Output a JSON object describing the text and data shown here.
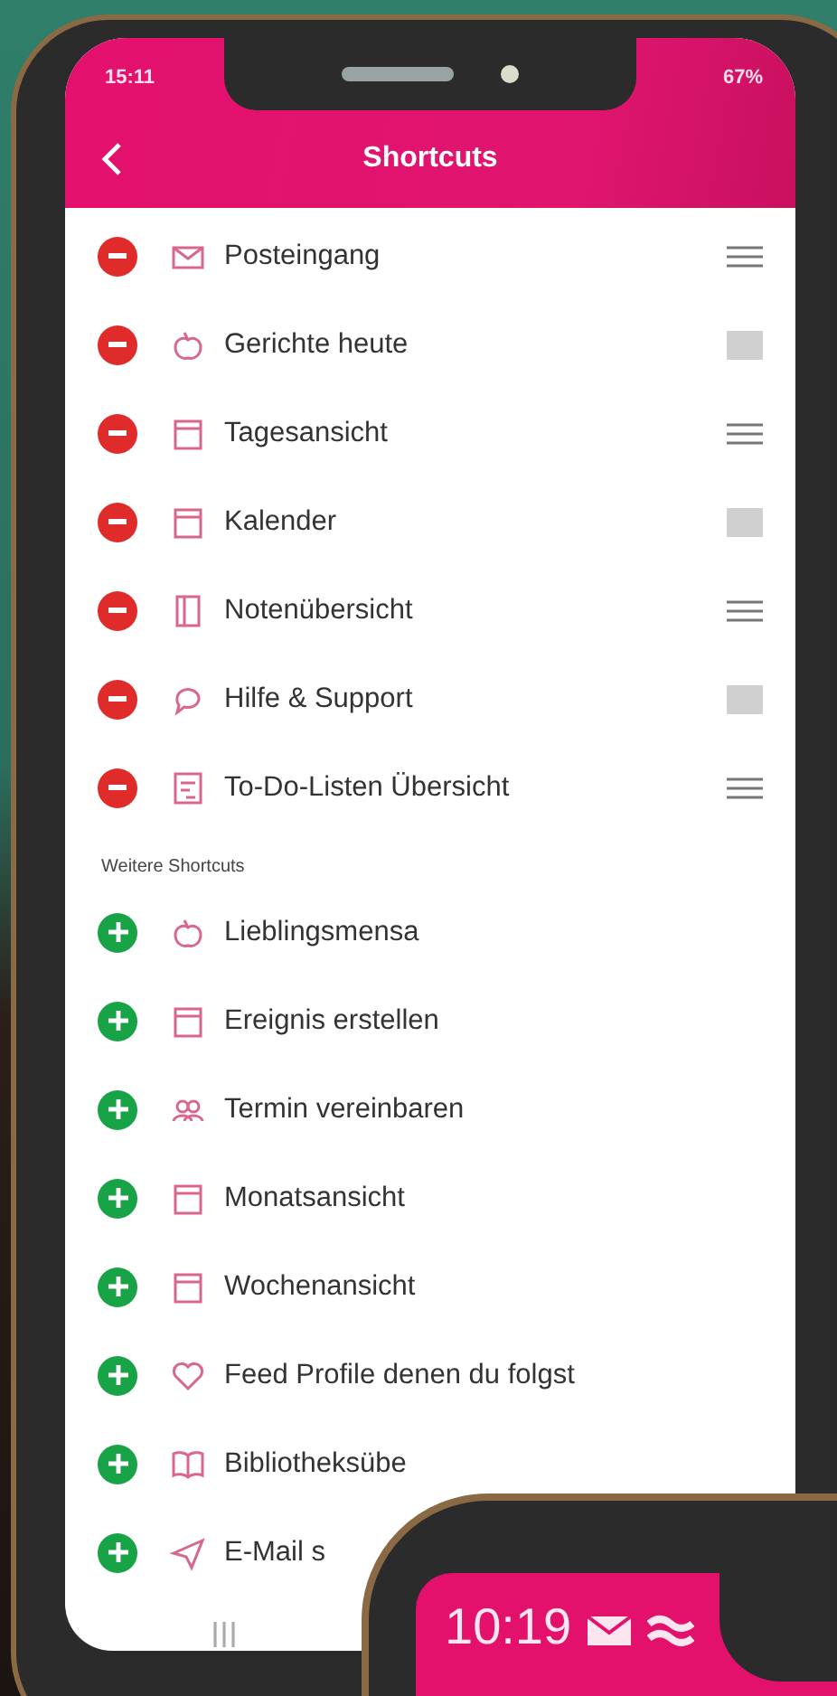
{
  "status_bar": {
    "time": "15:11",
    "battery": "67%"
  },
  "header": {
    "title": "Shortcuts"
  },
  "active_shortcuts": [
    {
      "label": "Posteingang",
      "kind": "lines"
    },
    {
      "label": "Gerichte heute",
      "kind": "square"
    },
    {
      "label": "Tagesansicht",
      "kind": "lines"
    },
    {
      "label": "Kalender",
      "kind": "square"
    },
    {
      "label": "Notenübersicht",
      "kind": "lines"
    },
    {
      "label": "Hilfe & Support",
      "kind": "square"
    },
    {
      "label": "To-Do-Listen Übersicht",
      "kind": "lines"
    }
  ],
  "more_section": {
    "title": "Weitere Shortcuts"
  },
  "more_shortcuts": [
    {
      "label": "Lieblingsmensa"
    },
    {
      "label": "Ereignis erstellen"
    },
    {
      "label": "Termin vereinbaren"
    },
    {
      "label": "Monatsansicht"
    },
    {
      "label": "Wochenansicht"
    },
    {
      "label": "Feed Profile denen du folgst"
    },
    {
      "label": "Bibliotheksübe"
    },
    {
      "label": "E-Mail s"
    }
  ],
  "second_phone": {
    "time": "10:19"
  }
}
